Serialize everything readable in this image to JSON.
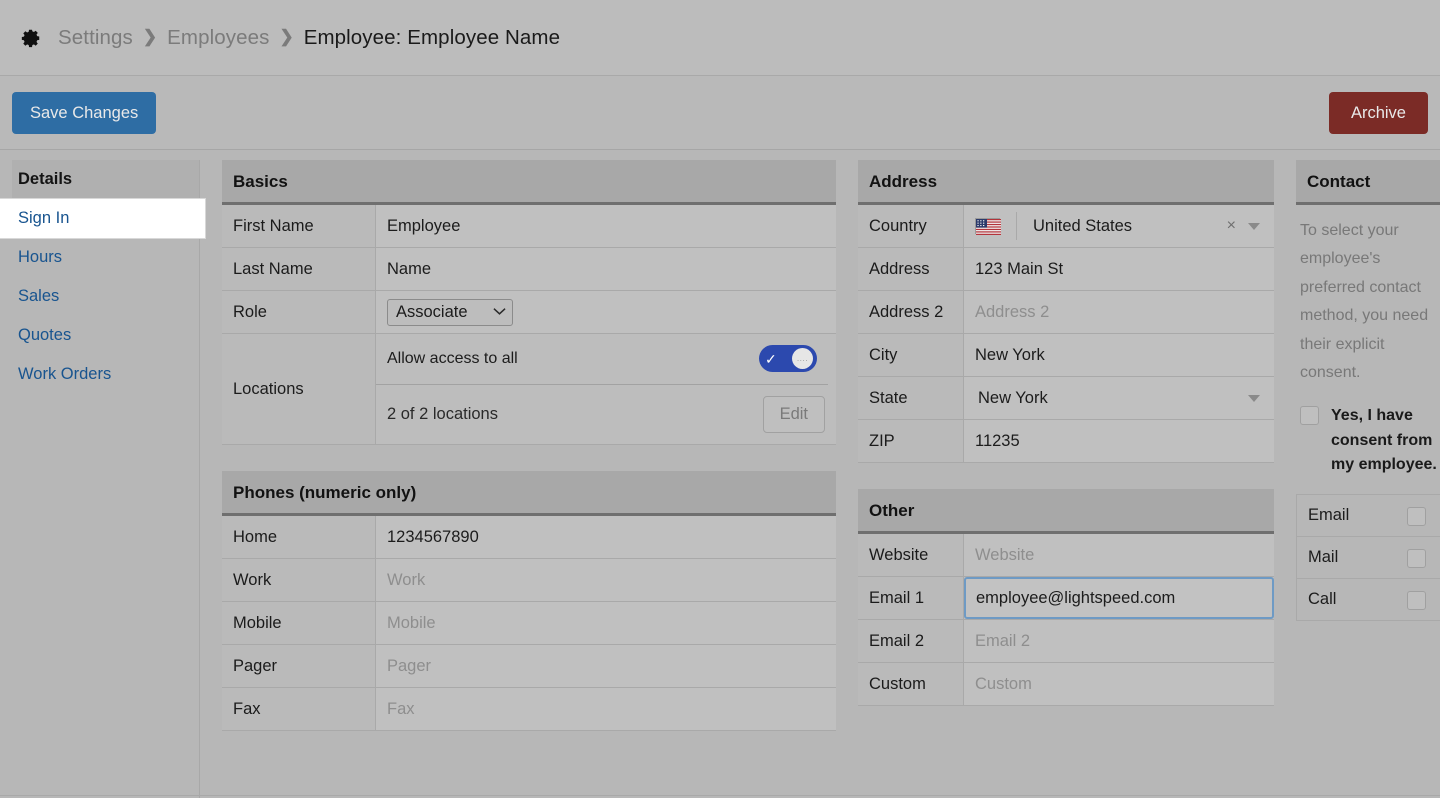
{
  "header": {
    "gear_icon": "gear-icon",
    "breadcrumbs": [
      {
        "label": "Settings",
        "current": false
      },
      {
        "label": "Employees",
        "current": false
      },
      {
        "label": "Employee: Employee Name",
        "current": true
      }
    ],
    "separator": "❯"
  },
  "toolbar": {
    "save_label": "Save Changes",
    "archive_label": "Archive",
    "save_color": "#2e6da4",
    "archive_color": "#7b2b26"
  },
  "sidebar": {
    "items": [
      {
        "label": "Details",
        "type": "heading"
      },
      {
        "label": "Sign In",
        "type": "link",
        "selected": true
      },
      {
        "label": "Hours",
        "type": "link"
      },
      {
        "label": "Sales",
        "type": "link"
      },
      {
        "label": "Quotes",
        "type": "link"
      },
      {
        "label": "Work Orders",
        "type": "link"
      }
    ],
    "link_color": "#18548f"
  },
  "basics": {
    "title": "Basics",
    "first_name": {
      "label": "First Name",
      "value": "Employee"
    },
    "last_name": {
      "label": "Last Name",
      "value": "Name"
    },
    "role": {
      "label": "Role",
      "value": "Associate",
      "chevron": "⌄"
    },
    "locations": {
      "label": "Locations",
      "allow_all_label": "Allow access to all",
      "toggle_on": true,
      "toggle_check": "✓",
      "toggle_knob_dots": "․․․․",
      "count_text": "2 of 2 locations",
      "edit_label": "Edit",
      "toggle_color": "#2c49ae"
    }
  },
  "phones": {
    "title": "Phones (numeric only)",
    "rows": [
      {
        "label": "Home",
        "value": "1234567890",
        "placeholder": "Home",
        "filled": true
      },
      {
        "label": "Work",
        "value": "",
        "placeholder": "Work",
        "filled": false
      },
      {
        "label": "Mobile",
        "value": "",
        "placeholder": "Mobile",
        "filled": false
      },
      {
        "label": "Pager",
        "value": "",
        "placeholder": "Pager",
        "filled": false
      },
      {
        "label": "Fax",
        "value": "",
        "placeholder": "Fax",
        "filled": false
      }
    ]
  },
  "address": {
    "title": "Address",
    "country": {
      "label": "Country",
      "value": "United States",
      "flag_icon": "us-flag-icon",
      "clear_icon": "×",
      "dropdown_icon": "chevron-down-icon"
    },
    "rows": [
      {
        "label": "Address",
        "value": "123 Main St",
        "placeholder": "Address",
        "filled": true
      },
      {
        "label": "Address 2",
        "value": "",
        "placeholder": "Address 2",
        "filled": false
      },
      {
        "label": "City",
        "value": "New York",
        "placeholder": "City",
        "filled": true
      }
    ],
    "state": {
      "label": "State",
      "value": "New York",
      "dropdown_icon": "caret-down-icon"
    },
    "zip": {
      "label": "ZIP",
      "value": "11235",
      "placeholder": "ZIP",
      "filled": true
    }
  },
  "other": {
    "title": "Other",
    "rows": [
      {
        "label": "Website",
        "value": "",
        "placeholder": "Website",
        "filled": false,
        "focused": false
      },
      {
        "label": "Email 1",
        "value": "employee@lightspeed.com",
        "placeholder": "Email 1",
        "filled": true,
        "focused": true
      },
      {
        "label": "Email 2",
        "value": "",
        "placeholder": "Email 2",
        "filled": false,
        "focused": false
      },
      {
        "label": "Custom",
        "value": "",
        "placeholder": "Custom",
        "filled": false,
        "focused": false
      }
    ],
    "focus_border_color": "#6e9ac4"
  },
  "contact": {
    "title": "Contact",
    "note": "To select your employee's preferred contact method, you need their explicit consent.",
    "consent_label": "Yes, I have consent from my employee.",
    "consent_checked": false,
    "methods": [
      {
        "label": "Email",
        "checked": false
      },
      {
        "label": "Mail",
        "checked": false
      },
      {
        "label": "Call",
        "checked": false
      }
    ]
  }
}
